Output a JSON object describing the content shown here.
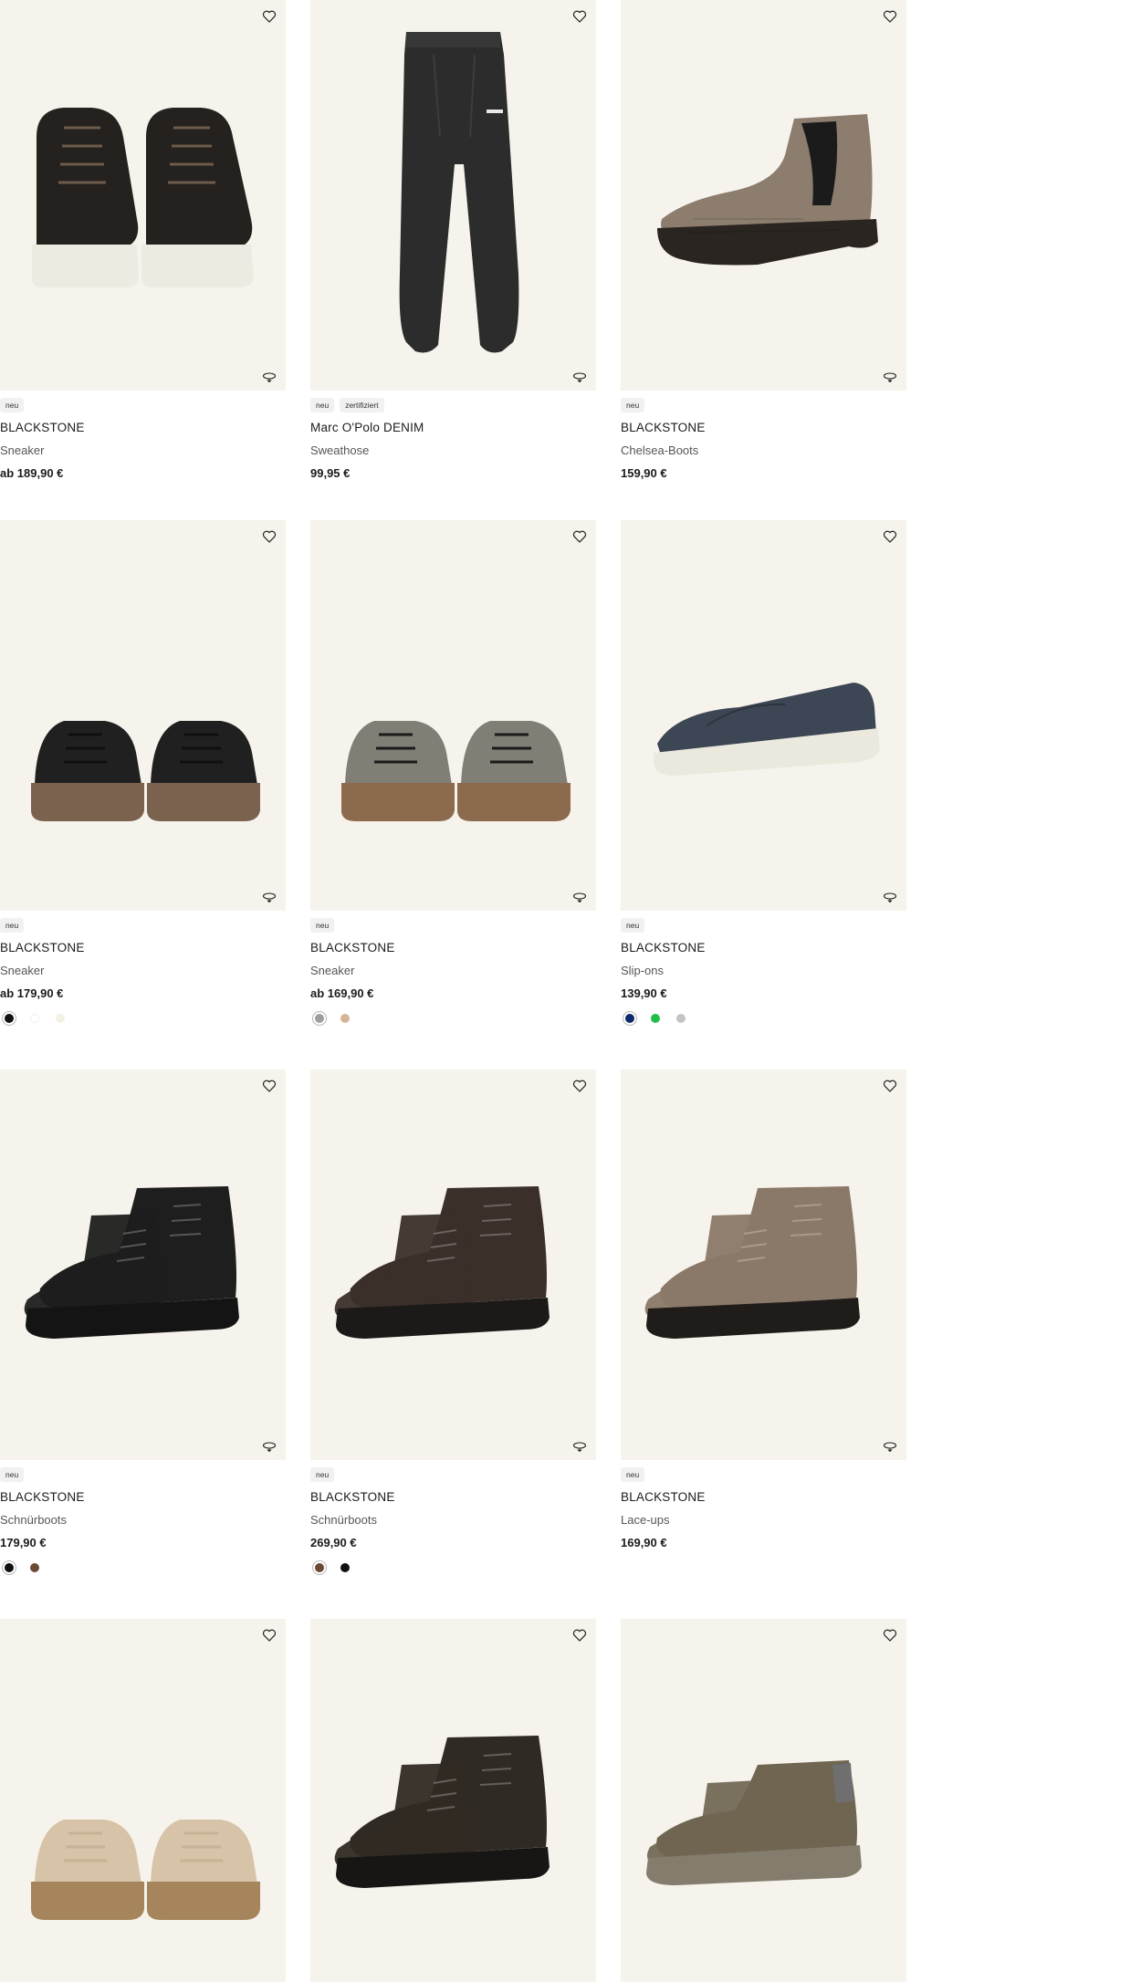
{
  "labels": {
    "new_badge": "neu",
    "certified_badge": "zertifiziert"
  },
  "icons": {
    "wishlist": "heart-icon",
    "view_3d": "rotate-3d-icon"
  },
  "colors": {
    "image_bg": "#f6f3ec",
    "badge_bg": "#f1f1f1"
  },
  "products": [
    {
      "badges": [
        "neu"
      ],
      "brand": "BLACKSTONE",
      "type": "Sneaker",
      "price": "ab 189,90 €",
      "swatches": []
    },
    {
      "badges": [
        "neu",
        "zertifiziert"
      ],
      "brand": "Marc O'Polo DENIM",
      "type": "Sweathose",
      "price": "99,95 €",
      "swatches": []
    },
    {
      "badges": [
        "neu"
      ],
      "brand": "BLACKSTONE",
      "type": "Chelsea-Boots",
      "price": "159,90 €",
      "swatches": []
    },
    {
      "badges": [
        "neu"
      ],
      "brand": "BLACKSTONE",
      "type": "Sneaker",
      "price": "ab 179,90 €",
      "swatches": [
        "#111111",
        "#ffffff",
        "#f3f0e4"
      ]
    },
    {
      "badges": [
        "neu"
      ],
      "brand": "BLACKSTONE",
      "type": "Sneaker",
      "price": "ab 169,90 €",
      "swatches": [
        "#9e9e9e",
        "#d6b596"
      ]
    },
    {
      "badges": [
        "neu"
      ],
      "brand": "BLACKSTONE",
      "type": "Slip-ons",
      "price": "139,90 €",
      "swatches": [
        "#0f2a6b",
        "#1fbf4a",
        "#c4c4c4"
      ]
    },
    {
      "badges": [
        "neu"
      ],
      "brand": "BLACKSTONE",
      "type": "Schnürboots",
      "price": "179,90 €",
      "swatches": [
        "#111111",
        "#6b4a33"
      ]
    },
    {
      "badges": [
        "neu"
      ],
      "brand": "BLACKSTONE",
      "type": "Schnürboots",
      "price": "269,90 €",
      "swatches": [
        "#6b4a33",
        "#111111"
      ]
    },
    {
      "badges": [
        "neu"
      ],
      "brand": "BLACKSTONE",
      "type": "Lace-ups",
      "price": "169,90 €",
      "swatches": []
    },
    {
      "badges": [],
      "brand": "",
      "type": "",
      "price": "",
      "swatches": []
    },
    {
      "badges": [],
      "brand": "",
      "type": "",
      "price": "",
      "swatches": []
    },
    {
      "badges": [],
      "brand": "",
      "type": "",
      "price": "",
      "swatches": []
    }
  ]
}
